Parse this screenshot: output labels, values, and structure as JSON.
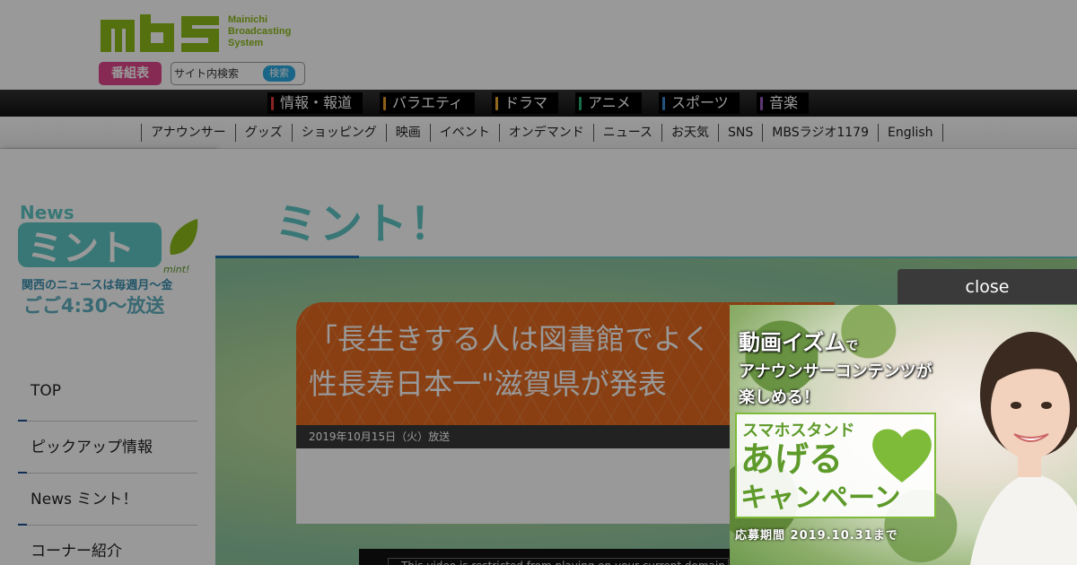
{
  "brand": {
    "logo_alt": "MBS",
    "subtitle": [
      "Mainichi",
      "Broadcasting",
      "System"
    ]
  },
  "header": {
    "program_guide_label": "番組表",
    "search": {
      "placeholder": "サイト内検索",
      "button_label": "検索"
    }
  },
  "genres": [
    {
      "label": "情報・報道",
      "color": "#e8393f"
    },
    {
      "label": "バラエティ",
      "color": "#f29b30"
    },
    {
      "label": "ドラマ",
      "color": "#f2b033"
    },
    {
      "label": "アニメ",
      "color": "#2ab57a"
    },
    {
      "label": "スポーツ",
      "color": "#3a89d0"
    },
    {
      "label": "音楽",
      "color": "#9a5bc4"
    }
  ],
  "subnav": [
    "アナウンサー",
    "グッズ",
    "ショッピング",
    "映画",
    "イベント",
    "オンデマンド",
    "ニュース",
    "お天気",
    "SNS",
    "MBSラジオ1179",
    "English"
  ],
  "sidebar": {
    "logo_text": {
      "news": "News",
      "mint": "ミント",
      "mint_en": "mint!",
      "tagline1": "関西のニュースは毎週月～金",
      "tagline2": "ごご4:30～放送"
    },
    "menu": [
      "TOP",
      "ピックアップ情報",
      "News ミント！",
      "コーナー紹介"
    ]
  },
  "main": {
    "title": "ミント！",
    "article": {
      "title_line1": "「長生きする人は図書館でよく",
      "title_line2": "性長寿日本一\"滋賀県が発表",
      "date": "2019年10月15日（火）放送"
    },
    "video_message": "This video is restricted from playing on your current domain"
  },
  "ad": {
    "close_label": "close",
    "line1": "動画イズム",
    "line1_suffix": "で",
    "line2": "アナウンサーコンテンツが",
    "line3": "楽しめる！",
    "card_line1": "スマホスタンド",
    "card_line2": "あげる",
    "card_line3": "キャンペーン",
    "footer": "応募期間 2019.10.31まで"
  },
  "colors": {
    "brand_green": "#8dbb1a",
    "mint_teal": "#5fc7c5",
    "article_orange": "#e5691e",
    "program_pink": "#e0468a",
    "search_blue": "#29a9e1"
  }
}
